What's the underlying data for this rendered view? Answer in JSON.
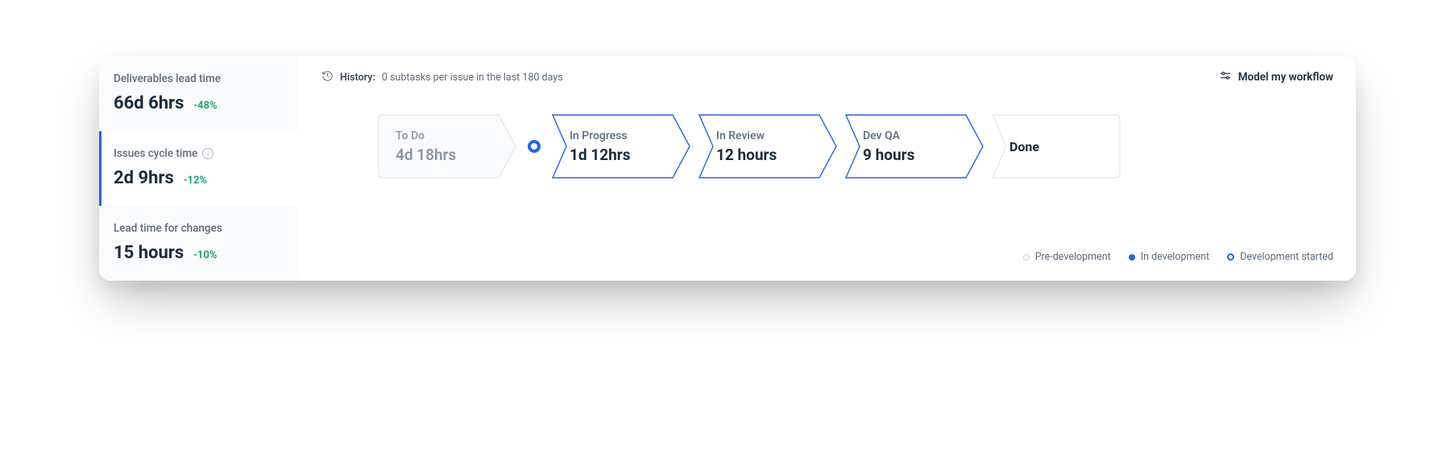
{
  "sidebar": {
    "metrics": [
      {
        "title": "Deliverables lead time",
        "value": "66d 6hrs",
        "delta": "-48%",
        "selected": false,
        "info": false
      },
      {
        "title": "Issues cycle time",
        "value": "2d 9hrs",
        "delta": "-12%",
        "selected": true,
        "info": true
      },
      {
        "title": "Lead time for changes",
        "value": "15 hours",
        "delta": "-10%",
        "selected": false,
        "info": false
      }
    ]
  },
  "header": {
    "history_label": "History:",
    "history_text": "0 subtasks per issue in the last 180 days",
    "model_btn": "Model my workflow"
  },
  "flow": {
    "stages": [
      {
        "title": "To Do",
        "value": "4d 18hrs",
        "kind": "pre"
      },
      {
        "title": "In Progress",
        "value": "1d 12hrs",
        "kind": "indev"
      },
      {
        "title": "In Review",
        "value": "12 hours",
        "kind": "indev"
      },
      {
        "title": "Dev QA",
        "value": "9 hours",
        "kind": "indev"
      },
      {
        "title": "Done",
        "value": "",
        "kind": "done"
      }
    ]
  },
  "legend": {
    "pre": "Pre-development",
    "indev": "In development",
    "start": "Development started"
  }
}
